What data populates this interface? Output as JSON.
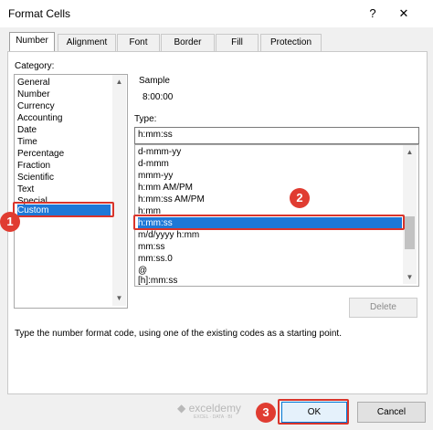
{
  "window": {
    "title": "Format Cells",
    "help": "?",
    "close": "✕"
  },
  "tabs": [
    {
      "label": "Number",
      "active": true
    },
    {
      "label": "Alignment"
    },
    {
      "label": "Font"
    },
    {
      "label": "Border"
    },
    {
      "label": "Fill"
    },
    {
      "label": "Protection"
    }
  ],
  "category": {
    "label": "Category:",
    "items": [
      "General",
      "Number",
      "Currency",
      "Accounting",
      "Date",
      "Time",
      "Percentage",
      "Fraction",
      "Scientific",
      "Text",
      "Special",
      "Custom"
    ],
    "selected": "Custom"
  },
  "sample": {
    "label": "Sample",
    "value": "8:00:00"
  },
  "type": {
    "label": "Type:",
    "value": "h:mm:ss",
    "items": [
      "d-mmm-yy",
      "d-mmm",
      "mmm-yy",
      "h:mm AM/PM",
      "h:mm:ss AM/PM",
      "h:mm",
      "h:mm:ss",
      "m/d/yyyy h:mm",
      "mm:ss",
      "mm:ss.0",
      "@",
      "[h]:mm:ss"
    ],
    "selected": "h:mm:ss"
  },
  "delete_label": "Delete",
  "description": "Type the number format code, using one of the existing codes as a starting point.",
  "ok_label": "OK",
  "cancel_label": "Cancel",
  "watermark": {
    "name": "exceldemy",
    "tagline": "EXCEL · DATA · BI"
  },
  "badges": [
    "1",
    "2",
    "3"
  ],
  "colors": {
    "selection": "#1e78d7",
    "annotation": "#e03c31"
  }
}
